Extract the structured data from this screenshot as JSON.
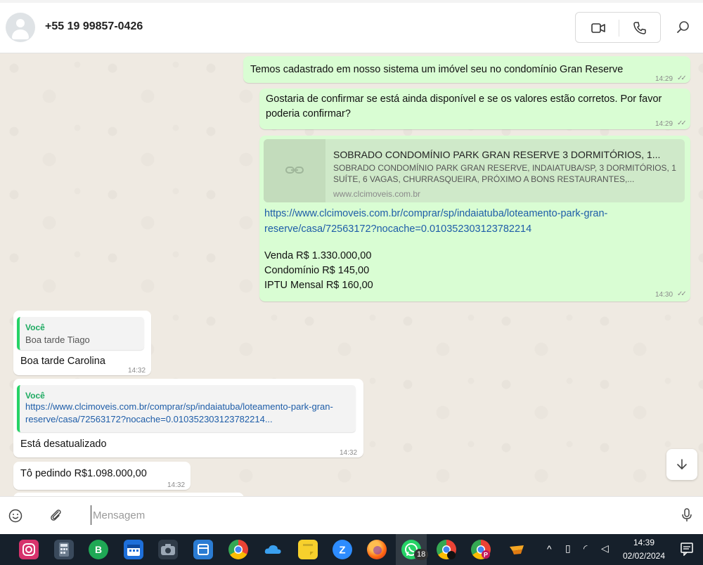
{
  "header": {
    "contact": "+55 19 99857-0426",
    "icons": [
      "video-call-icon",
      "phone-call-icon",
      "search-icon"
    ]
  },
  "messages": {
    "m1": {
      "text": "Temos cadastrado em nosso sistema um imóvel seu no condomínio Gran Reserve",
      "time": "14:29"
    },
    "m2": {
      "text": "Gostaria de confirmar se está ainda disponível e se os valores estão corretos. Por favor poderia confirmar?",
      "time": "14:29"
    },
    "m3": {
      "preview_title": "SOBRADO CONDOMÍNIO PARK GRAN RESERVE 3 DORMITÓRIOS, 1...",
      "preview_desc": "SOBRADO CONDOMÍNIO PARK GRAN RESERVE, INDAIATUBA/SP,  3 DORMITÓRIOS, 1 SUÍTE, 6 VAGAS, CHURRASQUEIRA, PRÓXIMO A BONS RESTAURANTES,...",
      "preview_domain": "www.clcimoveis.com.br",
      "link": "https://www.clcimoveis.com.br/comprar/sp/indaiatuba/loteamento-park-gran-reserve/casa/72563172?nocache=0.010352303123782214",
      "venda": "Venda R$ 1.330.000,00",
      "condominio": "Condomínio R$ 145,00",
      "iptu": "IPTU Mensal R$ 160,00",
      "time": "14:30"
    },
    "m4": {
      "quote_author": "Você",
      "quote_text": "Boa tarde Tiago",
      "text": "Boa tarde Carolina",
      "time": "14:32"
    },
    "m5": {
      "quote_author": "Você",
      "quote_text": "https://www.clcimoveis.com.br/comprar/sp/indaiatuba/loteamento-park-gran-reserve/casa/72563172?nocache=0.010352303123782214...",
      "text": "Está desatualizado",
      "time": "14:32"
    },
    "m6": {
      "text": "Tô pedindo R$1.098.000,00",
      "time": "14:32"
    }
  },
  "composer": {
    "placeholder": "Mensagem"
  },
  "taskbar": {
    "apps": [
      "instagram",
      "calculator",
      "whatsapp-business",
      "calendar",
      "camera",
      "office",
      "chrome",
      "onedrive",
      "sticky-notes",
      "zoom",
      "firefox",
      "whatsapp",
      "chrome-profile",
      "chrome-profile-p",
      "app"
    ],
    "whatsapp_badge": "18",
    "time": "14:39",
    "date": "02/02/2024"
  },
  "colors": {
    "outgoing": "#d9fdd3",
    "incoming": "#ffffff",
    "link": "#1e5da8",
    "quote_accent": "#25d366"
  }
}
